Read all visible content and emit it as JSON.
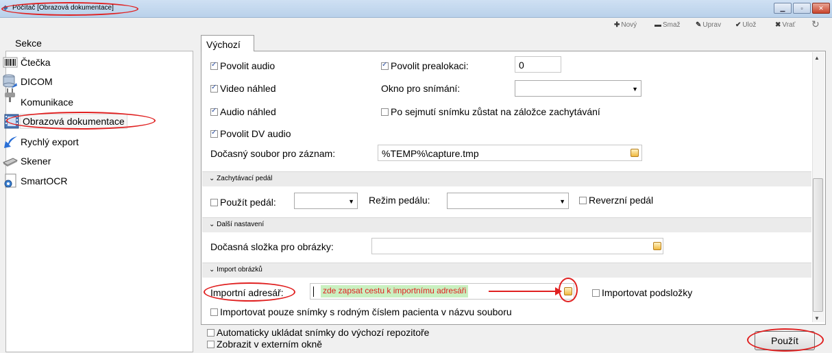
{
  "window": {
    "title": "Počítač [Obrazová dokumentace]",
    "buttons": [
      "minimize-icon",
      "maximize-icon",
      "close-icon"
    ]
  },
  "toolbar": {
    "new": "Nový",
    "delete": "Smaž",
    "edit": "Uprav",
    "save": "Ulož",
    "revert": "Vrať"
  },
  "sidebar": {
    "heading": "Sekce",
    "items": [
      {
        "label": "Čtečka",
        "icon": "barcode-icon"
      },
      {
        "label": "DICOM",
        "icon": "database-icon"
      },
      {
        "label": "Komunikace",
        "icon": "plug-icon"
      },
      {
        "label": "Obrazová dokumentace",
        "icon": "film-icon",
        "selected": true
      },
      {
        "label": "Rychlý export",
        "icon": "arrow-icon"
      },
      {
        "label": "Skener",
        "icon": "scanner-icon"
      },
      {
        "label": "SmartOCR",
        "icon": "ocr-icon"
      }
    ]
  },
  "tab": {
    "label": "Výchozí"
  },
  "settings": {
    "enable_audio": "Povolit audio",
    "video_preview": "Video náhled",
    "audio_preview": "Audio náhled",
    "enable_dv_audio": "Povolit DV audio",
    "enable_prealloc": "Povolit prealokaci:",
    "prealloc_value": "0",
    "capture_window": "Okno pro snímání:",
    "capture_window_value": "",
    "stay_on_tab": "Po sejmutí snímku zůstat na záložce zachytávání",
    "temp_file_label": "Dočasný soubor pro záznam:",
    "temp_file_value": "%TEMP%\\capture.tmp"
  },
  "pedal": {
    "header": "Zachytávací pedál",
    "use_pedal": "Použít pedál:",
    "pedal_mode": "Režim pedálu:",
    "reverse_pedal": "Reverzní pedál"
  },
  "more": {
    "header": "Další nastavení",
    "temp_folder_label": "Dočasná složka pro obrázky:",
    "temp_folder_value": ""
  },
  "import": {
    "header": "Import obrázků",
    "dir_label": "Importní adresář:",
    "dir_hint": "zde zapsat cestu k importnímu adresáři",
    "subfolders": "Importovat podsložky",
    "only_birth_number": "Importovat pouze snímky s rodným číslem pacienta v názvu souboru"
  },
  "footer": {
    "autosave": "Automaticky ukládat snímky do výchozí repozitoře",
    "external_window": "Zobrazit v externím okně",
    "apply": "Použít"
  },
  "colors": {
    "annotation": "#e02020",
    "hint_bg": "#c9f0c0",
    "hint_text": "#e02020"
  }
}
